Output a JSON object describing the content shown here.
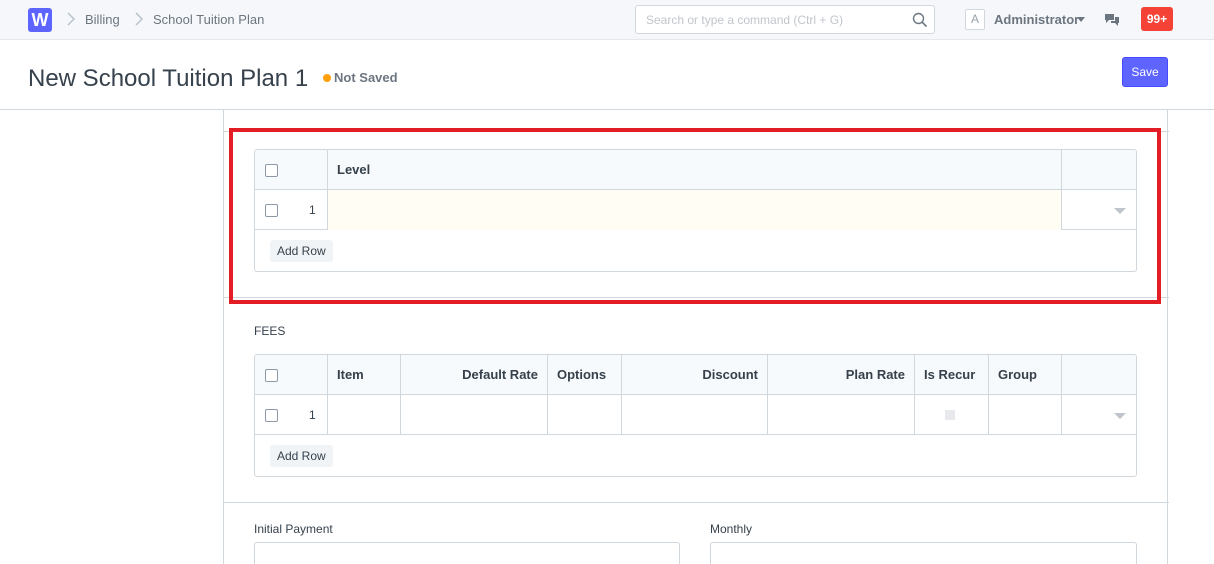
{
  "navbar": {
    "logo_letter": "W",
    "breadcrumbs": [
      "Billing",
      "School Tuition Plan"
    ],
    "search_placeholder": "Search or type a command (Ctrl + G)",
    "avatar_letter": "A",
    "user_name": "Administrator",
    "notification_count": "99+"
  },
  "page": {
    "title": "New School Tuition Plan 1",
    "status": "Not Saved",
    "save_label": "Save"
  },
  "levels_table": {
    "columns": [
      "Level"
    ],
    "rows": [
      {
        "idx": "1",
        "level": ""
      }
    ],
    "add_row_label": "Add Row"
  },
  "fees_section": {
    "label": "FEES",
    "columns": [
      "Item",
      "Default Rate",
      "Options",
      "Discount",
      "Plan Rate",
      "Is Recur",
      "Group"
    ],
    "rows": [
      {
        "idx": "1"
      }
    ],
    "add_row_label": "Add Row"
  },
  "payment_fields": {
    "initial_payment_label": "Initial Payment",
    "monthly_label": "Monthly"
  },
  "colors": {
    "accent": "#5e64ff",
    "status_dot": "#ffa00a",
    "highlight": "#e31d25",
    "badge": "#f44336"
  }
}
